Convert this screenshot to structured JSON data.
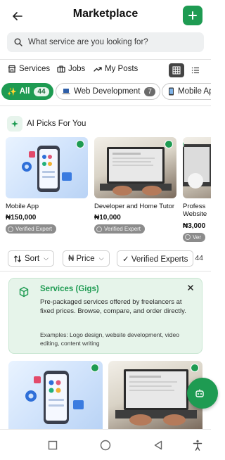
{
  "header": {
    "title": "Marketplace",
    "back_icon": "arrow-left-icon",
    "add_icon": "plus-icon",
    "accent": "#1e9b52"
  },
  "search": {
    "placeholder": "What service are you looking for?",
    "value": "",
    "icon": "search-icon"
  },
  "nav_tabs": [
    {
      "label": "Services",
      "icon": "storefront-icon"
    },
    {
      "label": "Jobs",
      "icon": "briefcase-icon"
    },
    {
      "label": "My Posts",
      "icon": "trending-up-icon"
    }
  ],
  "view_toggle": {
    "grid_icon": "grid-icon",
    "list_icon": "list-icon",
    "selected": "grid"
  },
  "categories": [
    {
      "label": "All",
      "count": "44",
      "icon": "sparkles-icon",
      "active": true
    },
    {
      "label": "Web Development",
      "count": "7",
      "icon": "laptop-icon",
      "active": false
    },
    {
      "label": "Mobile Ap",
      "icon": "smartphone-icon",
      "active": false
    }
  ],
  "ai_picks": {
    "title": "AI Picks For You",
    "icon": "sparkle-icon",
    "items": [
      {
        "title": "Mobile App",
        "price": "₦150,000",
        "badge": "Verified Expert",
        "image": "mobile-app-illustration"
      },
      {
        "title": "Developer and Home Tutor",
        "price": "₦10,000",
        "badge": "Verified Expert",
        "image": "laptop-typing-photo"
      },
      {
        "title": "Profess",
        "title_line2": "Website",
        "price": "₦3,000",
        "badge": "Ver",
        "image": "laptop-photo"
      }
    ]
  },
  "filters": {
    "sort": "Sort",
    "price": "₦ Price",
    "verified": "✓ Verified Experts",
    "result_count": "44"
  },
  "info_card": {
    "title": "Services (Gigs)",
    "description": "Pre-packaged services offered by freelancers at fixed prices. Browse, compare, and order directly.",
    "examples": "Examples: Logo design, website development, video editing, content writing",
    "icon": "package-icon",
    "close_icon": "close-icon"
  },
  "fab": {
    "icon": "robot-icon"
  },
  "system_nav": {
    "recents": "square-icon",
    "home": "circle-icon",
    "back": "triangle-back-icon",
    "accessibility": "accessibility-icon"
  }
}
